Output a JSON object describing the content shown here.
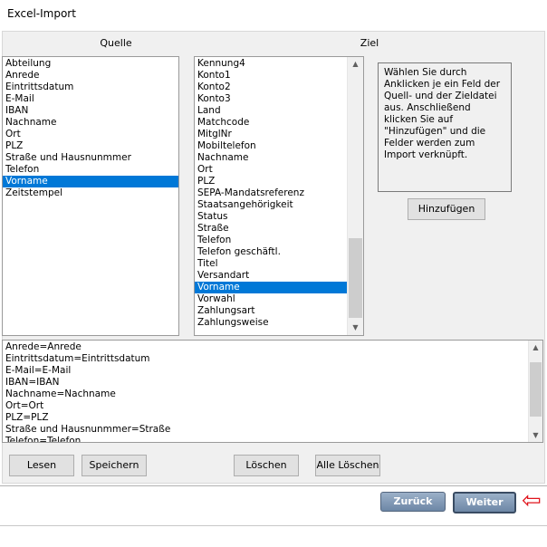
{
  "window": {
    "title": "Excel-Import"
  },
  "source": {
    "header": "Quelle",
    "items": [
      "Abteilung",
      "Anrede",
      "Eintrittsdatum",
      "E-Mail",
      "IBAN",
      "Nachname",
      "Ort",
      "PLZ",
      "Straße und Hausnunmmer",
      "Telefon",
      "Vorname",
      "Zeitstempel"
    ],
    "selected_index": 10
  },
  "target": {
    "header": "Ziel",
    "items": [
      "Kennung4",
      "Konto1",
      "Konto2",
      "Konto3",
      "Land",
      "Matchcode",
      "MitglNr",
      "Mobiltelefon",
      "Nachname",
      "Ort",
      "PLZ",
      "SEPA-Mandatsreferenz",
      "Staatsangehörigkeit",
      "Status",
      "Straße",
      "Telefon",
      "Telefon geschäftl.",
      "Titel",
      "Versandart",
      "Vorname",
      "Vorwahl",
      "Zahlungsart",
      "Zahlungsweise"
    ],
    "selected_index": 19
  },
  "info_text": "Wählen Sie durch Anklicken je ein Feld der Quell- und der Zieldatei aus. Anschließend klicken Sie auf \"Hinzufügen\" und die Felder werden zum Import verknüpft.",
  "buttons": {
    "add": "Hinzufügen",
    "load": "Lesen",
    "save": "Speichern",
    "delete": "Löschen",
    "delete_all": "Alle Löschen",
    "back": "Zurück",
    "next": "Weiter"
  },
  "mappings": [
    "Anrede=Anrede",
    "Eintrittsdatum=Eintrittsdatum",
    "E-Mail=E-Mail",
    "IBAN=IBAN",
    "Nachname=Nachname",
    "Ort=Ort",
    "PLZ=PLZ",
    "Straße und Hausnunmmer=Straße",
    "Telefon=Telefon"
  ],
  "colors": {
    "selection": "#0078d7",
    "annotation_arrow": "#e0141c"
  },
  "icons": {
    "scroll_up": "chevron-up-icon",
    "scroll_down": "chevron-down-icon",
    "annotation": "red-arrow-icon"
  }
}
